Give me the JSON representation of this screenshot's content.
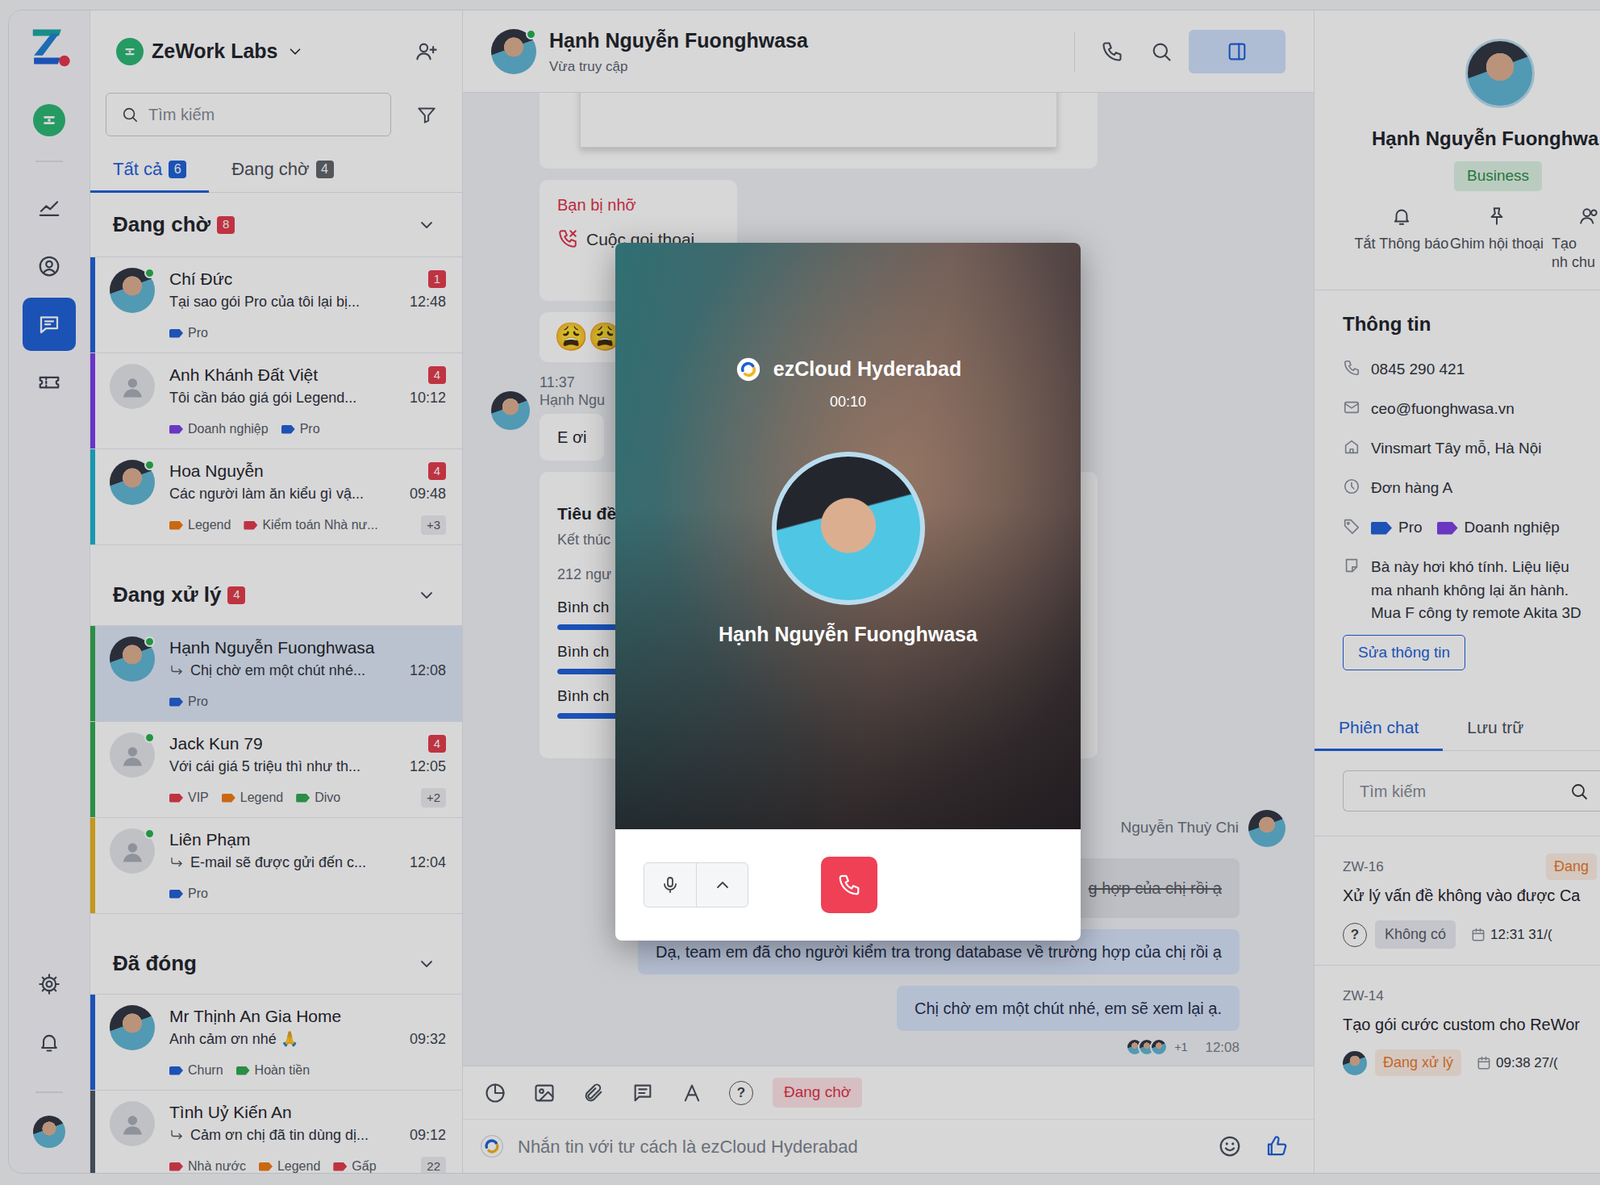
{
  "rail": {
    "items": [
      {
        "selected": false
      },
      {
        "selected": false
      },
      {
        "selected": true
      },
      {
        "selected": false
      }
    ]
  },
  "workspace": {
    "name": "ZeWork Labs"
  },
  "search": {
    "placeholder": "Tìm kiếm"
  },
  "tabs": [
    {
      "label": "Tất cả",
      "count": "6",
      "selected": true
    },
    {
      "label": "Đang chờ",
      "count": "4",
      "selected": false
    }
  ],
  "groups": [
    {
      "title": "Đang chờ",
      "count": "8",
      "expanded": true,
      "conversations": [
        {
          "name": "Chí Đức",
          "preview": "Tại sao gói Pro của tôi lại bị...",
          "time": "12:48",
          "unread": "1",
          "accent": "#1f5fd6",
          "avatar": "photo",
          "online": true,
          "reply": false,
          "selected": false,
          "tags": [
            {
              "label": "Pro",
              "color": "#2160d4"
            }
          ]
        },
        {
          "name": "Anh Khánh Đất Việt",
          "preview": "Tôi cần báo giá gói Legend...",
          "time": "10:12",
          "unread": "4",
          "accent": "#7c3aed",
          "avatar": "default",
          "online": false,
          "reply": false,
          "selected": false,
          "tags": [
            {
              "label": "Doanh nghiệp",
              "color": "#7b3fe4"
            },
            {
              "label": "Pro",
              "color": "#2160d4"
            }
          ]
        },
        {
          "name": "Hoa Nguyễn",
          "preview": "Các người làm ăn kiểu gì vậ...",
          "time": "09:48",
          "unread": "4",
          "accent": "#18b4cf",
          "avatar": "photo",
          "online": true,
          "reply": false,
          "selected": false,
          "tags": [
            {
              "label": "Legend",
              "color": "#f07a12"
            },
            {
              "label": "Kiểm toán Nhà nư...",
              "color": "#e23a4a"
            }
          ],
          "more": "+3"
        }
      ]
    },
    {
      "title": "Đang xử lý",
      "count": "4",
      "expanded": true,
      "conversations": [
        {
          "name": "Hạnh Nguyễn Fuonghwasa",
          "preview": "Chị chờ em một chút nhé...",
          "time": "12:08",
          "accent": "#2fa84f",
          "avatar": "photo",
          "online": true,
          "reply": true,
          "selected": true,
          "tags": [
            {
              "label": "Pro",
              "color": "#2160d4"
            }
          ]
        },
        {
          "name": "Jack Kun 79",
          "preview": "Với cái giá 5 triệu thì như th...",
          "time": "12:05",
          "unread": "4",
          "accent": "#2fa84f",
          "avatar": "default",
          "online": true,
          "reply": false,
          "selected": false,
          "tags": [
            {
              "label": "VIP",
              "color": "#e23a4a"
            },
            {
              "label": "Legend",
              "color": "#f07a12"
            },
            {
              "label": "Divo",
              "color": "#2fa84f"
            }
          ],
          "more": "+2"
        },
        {
          "name": "Liên Phạm",
          "preview": "E-mail sẽ được gửi đến c...",
          "time": "12:04",
          "accent": "#e8b21a",
          "avatar": "default",
          "online": true,
          "reply": true,
          "selected": false,
          "tags": [
            {
              "label": "Pro",
              "color": "#2160d4"
            }
          ]
        }
      ]
    },
    {
      "title": "Đã đóng",
      "expanded": true,
      "conversations": [
        {
          "name": "Mr Thịnh An Gia Home",
          "preview": "Anh cảm ơn nhé 🙏",
          "time": "09:32",
          "accent": "#1f5fd6",
          "avatar": "photo",
          "online": false,
          "reply": false,
          "selected": false,
          "tags": [
            {
              "label": "Churn",
              "color": "#2160d4"
            },
            {
              "label": "Hoàn tiền",
              "color": "#2fa84f"
            }
          ]
        },
        {
          "name": "Tình Uỷ Kiến An",
          "preview": "Cảm ơn chị đã tin dùng dị...",
          "time": "09:12",
          "accent": "#4b5563",
          "avatar": "default",
          "online": false,
          "reply": true,
          "selected": false,
          "tags": [
            {
              "label": "Nhà nước",
              "color": "#e23a4a"
            },
            {
              "label": "Legend",
              "color": "#f07a12"
            },
            {
              "label": "Gấp",
              "color": "#e23a4a"
            }
          ],
          "more": "22"
        }
      ]
    }
  ],
  "chat": {
    "header": {
      "name": "Hạnh Nguyễn Fuonghwasa",
      "status": "Vừa truy cập",
      "panel_open": true
    },
    "messages": [
      {
        "kind": "image"
      },
      {
        "kind": "missed-call",
        "title": "Bạn bị nhỡ",
        "label": "Cuộc gọi thoại"
      },
      {
        "kind": "emoji",
        "text": "😩😩"
      },
      {
        "kind": "incoming",
        "time": "11:37",
        "sender": "Hạnh Ngu",
        "text": "E ơi"
      },
      {
        "kind": "poll",
        "title": "Tiêu đề",
        "subtitle": "Kết thúc",
        "votes": "212 ngư",
        "options": [
          {
            "label": "Bình ch",
            "level": 0.8
          },
          {
            "label": "Bình ch",
            "level": 0.55
          },
          {
            "label": "Bình ch",
            "level": 0.35
          }
        ]
      },
      {
        "kind": "agent",
        "sender": "Nguyễn Thuỳ Chi"
      },
      {
        "kind": "recalled",
        "text": "g hợp của chị rồi ạ"
      },
      {
        "kind": "outgoing",
        "text": "Dạ, team em đã cho người kiểm tra trong database về trường hợp của chị rồi ạ"
      },
      {
        "kind": "outgoing",
        "text": "Chị chờ em một chút nhé, em sẽ xem lại ạ."
      },
      {
        "kind": "seen",
        "extra": "+1",
        "time": "12:08"
      }
    ]
  },
  "composer": {
    "help": "?",
    "status": "Đang chờ",
    "placeholder": "Nhắn tin với tư cách là ezCloud Hyderabad"
  },
  "call": {
    "caller": "ezCloud Hyderabad",
    "timer": "00:10",
    "name": "Hạnh Nguyễn Fuonghwasa",
    "muted": false
  },
  "profile": {
    "name": "Hạnh Nguyễn Fuonghwa",
    "plan": "Business",
    "actions": [
      {
        "label": "Tắt Thông báo",
        "kind": "bell"
      },
      {
        "label": "Ghim hội thoại",
        "kind": "pin"
      },
      {
        "label": "Tạo nh chu",
        "kind": "group"
      }
    ],
    "info_title": "Thông tin",
    "fields": [
      {
        "kind": "phone",
        "value": "0845 290 421"
      },
      {
        "kind": "email",
        "value": "ceo@fuonghwasa.vn"
      },
      {
        "kind": "address",
        "value": "Vinsmart Tây mỗ, Hà Nội"
      },
      {
        "kind": "order",
        "value": "Đơn hàng A"
      },
      {
        "kind": "tags",
        "tags": [
          {
            "label": "Pro",
            "color": "#2160d4"
          },
          {
            "label": "Doanh nghiệp",
            "color": "#7b3fe4"
          }
        ]
      },
      {
        "kind": "note",
        "value": "Bà này hơi khó tính. Liệu liệu ma nhanh không lại ăn hành. Mua F công ty remote Akita 3D"
      }
    ],
    "edit": "Sửa thông tin",
    "tabs": [
      {
        "label": "Phiên chat",
        "selected": true
      },
      {
        "label": "Lưu trữ",
        "selected": false
      }
    ],
    "search": {
      "placeholder": "Tìm kiếm"
    },
    "tickets": [
      {
        "kind": "unassigned",
        "id": "ZW-16",
        "status": "Đang",
        "color": "#e8782a",
        "title": "Xử lý vấn đề không vào được Ca",
        "help": "?",
        "assignee": "Không có",
        "time": "12:31 31/("
      },
      {
        "kind": "assigned",
        "id": "ZW-14",
        "status": "Đang xử lý",
        "color": "#e8782a",
        "title": "Tạo gói cước custom cho ReWor",
        "time": "09:38 27/("
      }
    ]
  }
}
